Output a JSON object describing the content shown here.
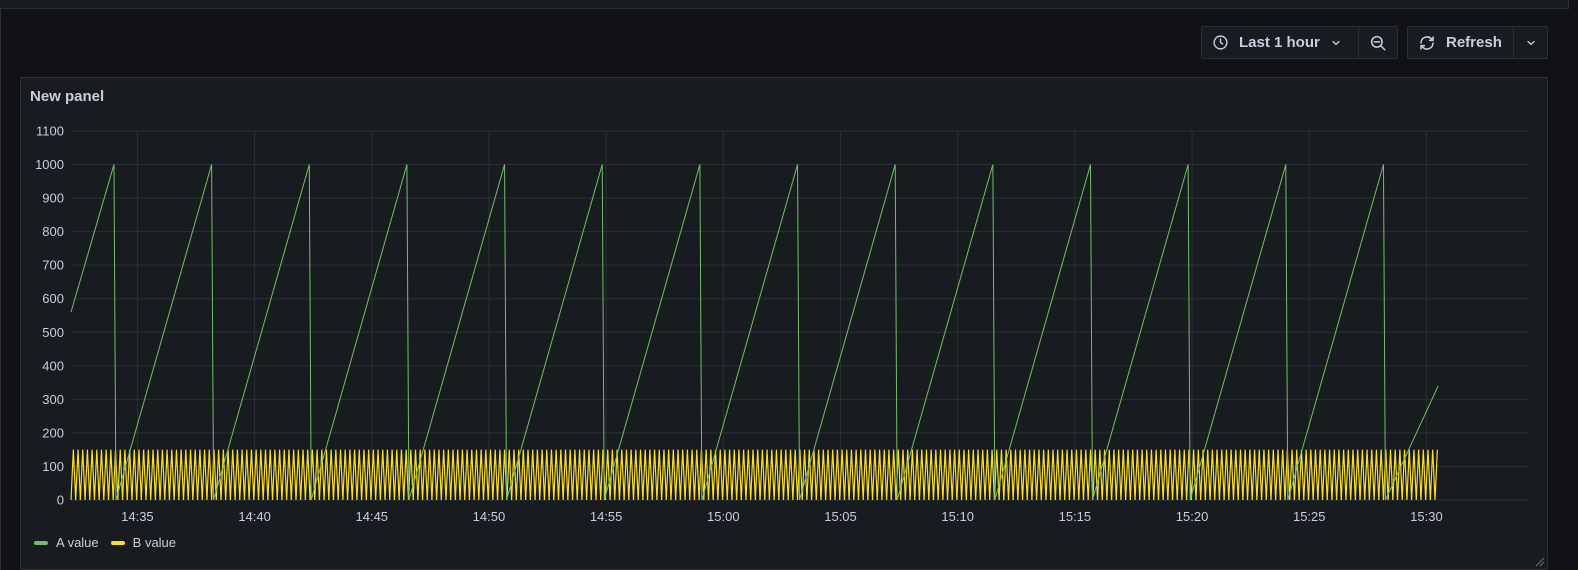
{
  "toolbar": {
    "time_range_label": "Last 1 hour",
    "refresh_label": "Refresh",
    "icons": {
      "clock": "clock-icon",
      "chevron": "chevron-down-icon",
      "zoom_out": "zoom-out-icon",
      "refresh": "refresh-icon"
    }
  },
  "panel": {
    "title": "New panel"
  },
  "colors": {
    "background": "#111217",
    "panel": "#181b1f",
    "border": "#2c2f36",
    "grid": "#2c2f36",
    "text": "#ccccdc",
    "series_a": "#73bf69",
    "series_b": "#fade2a"
  },
  "chart_data": {
    "type": "line",
    "title": "",
    "xlabel": "",
    "ylabel": "",
    "ylim": [
      0,
      1100
    ],
    "yticks": [
      0,
      100,
      200,
      300,
      400,
      500,
      600,
      700,
      800,
      900,
      1000,
      1100
    ],
    "xlim": [
      "14:32:10",
      "15:34:20"
    ],
    "xticks": [
      "14:35",
      "14:40",
      "14:45",
      "14:50",
      "14:55",
      "15:00",
      "15:05",
      "15:10",
      "15:15",
      "15:20",
      "15:25",
      "15:30"
    ],
    "grid": true,
    "legend_placement": "bottom-left",
    "series": [
      {
        "name": "A value",
        "color": "#73bf69",
        "x": [
          "14:32:10",
          "14:34:00",
          "14:34:05",
          "14:38:10",
          "14:38:15",
          "14:42:20",
          "14:42:25",
          "14:46:30",
          "14:46:35",
          "14:50:40",
          "14:50:45",
          "14:54:50",
          "14:54:55",
          "14:59:00",
          "14:59:05",
          "15:03:10",
          "15:03:15",
          "15:07:20",
          "15:07:25",
          "15:11:30",
          "15:11:35",
          "15:15:40",
          "15:15:45",
          "15:19:50",
          "15:19:55",
          "15:24:00",
          "15:24:05",
          "15:28:10",
          "15:28:15",
          "15:30:30"
        ],
        "values": [
          560,
          1000,
          0,
          1000,
          0,
          1000,
          0,
          1000,
          0,
          1000,
          0,
          1000,
          0,
          1000,
          0,
          1000,
          0,
          1000,
          0,
          1000,
          0,
          1000,
          0,
          1000,
          0,
          1000,
          0,
          1000,
          0,
          340
        ]
      },
      {
        "name": "B value",
        "color": "#fade2a",
        "description_range": [
          0,
          150
        ],
        "x_start": "14:32:10",
        "x_end": "15:30:30",
        "period_seconds": 12,
        "min": 0,
        "max": 150
      }
    ]
  }
}
